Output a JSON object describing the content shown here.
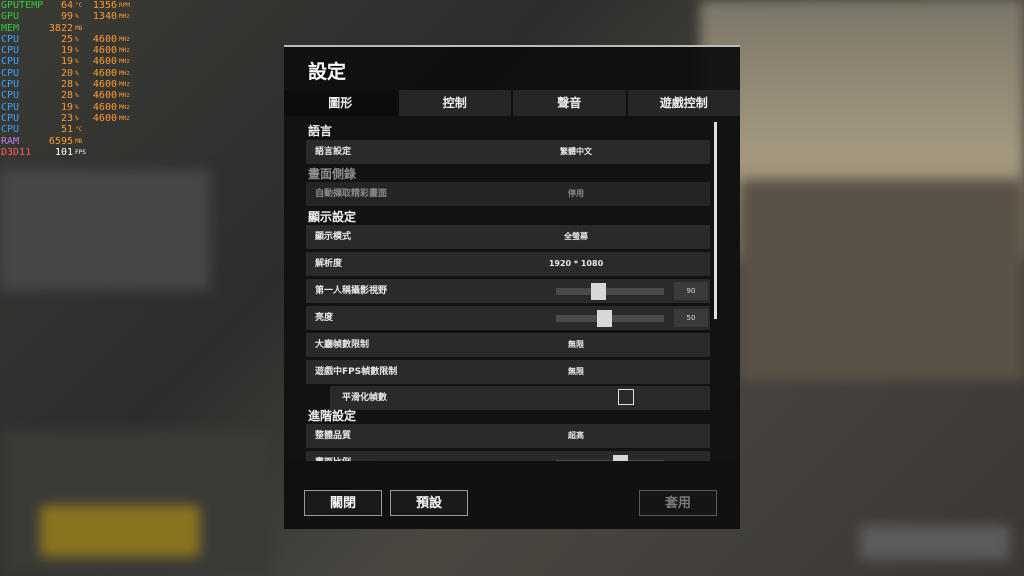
{
  "overlay": {
    "rows": [
      {
        "name": "GPUTEMP",
        "color": "green",
        "v1": "64",
        "u1": "°C",
        "v2": "1356",
        "u2": "RPM"
      },
      {
        "name": "GPU",
        "color": "green",
        "v1": "99",
        "u1": "%",
        "v2": "1340",
        "u2": "MHz"
      },
      {
        "name": "MEM",
        "color": "green",
        "v1": "3822",
        "u1": "MB",
        "v2": "",
        "u2": ""
      },
      {
        "name": "CPU",
        "color": "blue",
        "v1": "25",
        "u1": "%",
        "v2": "4600",
        "u2": "MHz"
      },
      {
        "name": "CPU",
        "color": "blue",
        "v1": "19",
        "u1": "%",
        "v2": "4600",
        "u2": "MHz"
      },
      {
        "name": "CPU",
        "color": "blue",
        "v1": "19",
        "u1": "%",
        "v2": "4600",
        "u2": "MHz"
      },
      {
        "name": "CPU",
        "color": "blue",
        "v1": "20",
        "u1": "%",
        "v2": "4600",
        "u2": "MHz"
      },
      {
        "name": "CPU",
        "color": "blue",
        "v1": "28",
        "u1": "%",
        "v2": "4600",
        "u2": "MHz"
      },
      {
        "name": "CPU",
        "color": "blue",
        "v1": "28",
        "u1": "%",
        "v2": "4600",
        "u2": "MHz"
      },
      {
        "name": "CPU",
        "color": "blue",
        "v1": "19",
        "u1": "%",
        "v2": "4600",
        "u2": "MHz"
      },
      {
        "name": "CPU",
        "color": "blue",
        "v1": "23",
        "u1": "%",
        "v2": "4600",
        "u2": "MHz"
      },
      {
        "name": "CPU",
        "color": "blue",
        "v1": "51",
        "u1": "°C",
        "v2": "",
        "u2": ""
      },
      {
        "name": "RAM",
        "color": "purple",
        "v1": "6595",
        "u1": "MB",
        "v2": "",
        "u2": ""
      },
      {
        "name": "D3D11",
        "color": "red",
        "v1": "101",
        "u1": "FPS",
        "v2": "",
        "u2": ""
      }
    ]
  },
  "dialog": {
    "title": "設定",
    "tabs": [
      {
        "label": "圖形",
        "active": true
      },
      {
        "label": "控制",
        "active": false
      },
      {
        "label": "聲音",
        "active": false
      },
      {
        "label": "遊戲控制",
        "active": false
      }
    ],
    "sections": {
      "language": "語言",
      "replay": "畫面側錄",
      "display": "顯示設定",
      "advanced": "進階設定"
    },
    "rows": {
      "language_setting": {
        "label": "語言設定",
        "value": "繁體中文"
      },
      "auto_capture": {
        "label": "自動擷取精彩畫面",
        "value": "停用"
      },
      "display_mode": {
        "label": "顯示模式",
        "value": "全螢幕"
      },
      "resolution": {
        "label": "解析度",
        "value": "1920 * 1080"
      },
      "fov": {
        "label": "第一人稱攝影視野",
        "value": "90",
        "fraction": 0.38
      },
      "brightness": {
        "label": "亮度",
        "value": "50",
        "fraction": 0.44
      },
      "lobby_fps": {
        "label": "大廳幀數限制",
        "value": "無限"
      },
      "ingame_fps": {
        "label": "遊戲中FPS幀數限制",
        "value": "無限"
      },
      "smooth_fps": {
        "label": "平滑化幀數",
        "checked": false
      },
      "overall_quality": {
        "label": "整體品質",
        "value": "超高"
      },
      "screen_scale": {
        "label": "畫面比例"
      }
    },
    "buttons": {
      "close": "關閉",
      "default": "預設",
      "apply": "套用"
    }
  }
}
